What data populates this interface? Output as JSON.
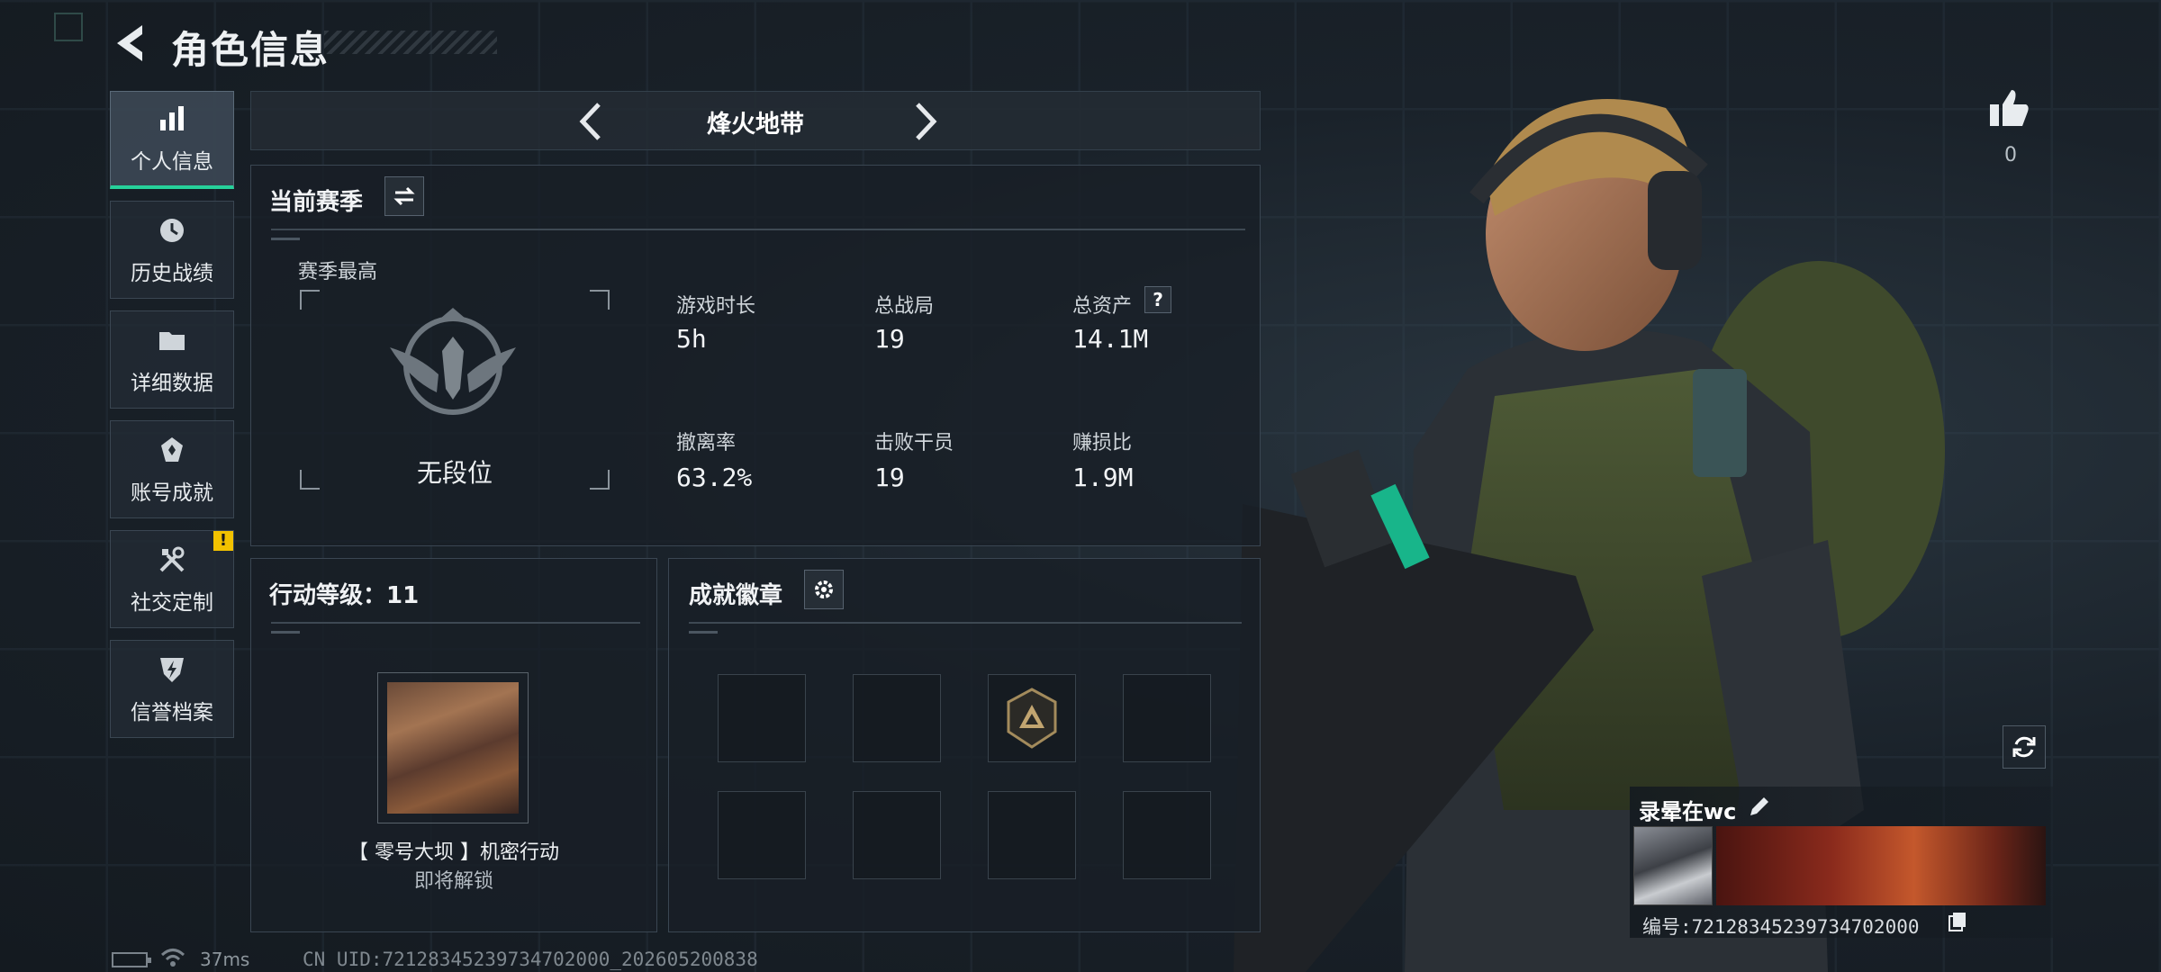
{
  "header": {
    "title": "角色信息"
  },
  "sidebar": {
    "items": [
      {
        "label": "个人信息",
        "icon": "bar-chart-icon",
        "active": true
      },
      {
        "label": "历史战绩",
        "icon": "history-clock-icon",
        "active": false
      },
      {
        "label": "详细数据",
        "icon": "folder-icon",
        "active": false
      },
      {
        "label": "账号成就",
        "icon": "achievement-medal-icon",
        "active": false
      },
      {
        "label": "社交定制",
        "icon": "tools-icon",
        "active": false,
        "alert": "!"
      },
      {
        "label": "信誉档案",
        "icon": "shield-lightning-icon",
        "active": false
      }
    ]
  },
  "mode": {
    "label": "烽火地带"
  },
  "season": {
    "title": "当前赛季",
    "best_label": "赛季最高",
    "rank_text": "无段位",
    "stats": [
      {
        "label": "游戏时长",
        "value": "5h"
      },
      {
        "label": "总战局",
        "value": "19"
      },
      {
        "label": "总资产",
        "value": "14.1M",
        "help": "?"
      },
      {
        "label": "撤离率",
        "value": "63.2%"
      },
      {
        "label": "击败干员",
        "value": "19"
      },
      {
        "label": "赚损比",
        "value": "1.9M"
      }
    ]
  },
  "action_level": {
    "title": "行动等级：11",
    "operation_name": "【 零号大坝 】机密行动",
    "operation_status": "即将解锁"
  },
  "badges": {
    "title": "成就徽章",
    "slots_filled": [
      false,
      false,
      true,
      false,
      false,
      false,
      false,
      false
    ]
  },
  "profile": {
    "likes": "0",
    "player_name": "录晕在wc",
    "player_id": "编号:7212834523973470200​0"
  },
  "footer": {
    "ping": "37ms",
    "uid": "CN UID:72128345239734702000_202605200838"
  },
  "colors": {
    "accent": "#26d19a",
    "alert": "#f2c200",
    "panel_bg": "#181f26"
  }
}
